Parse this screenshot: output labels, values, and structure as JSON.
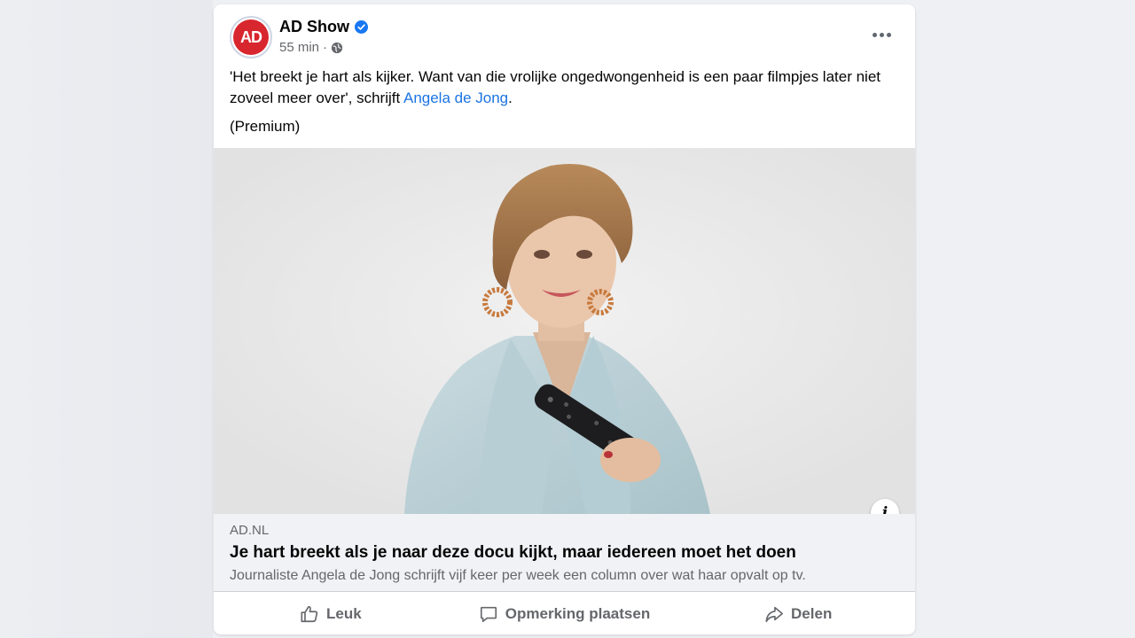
{
  "post": {
    "page_name": "AD Show",
    "avatar_text": "AD",
    "time": "55 min",
    "meta_sep": "·",
    "text_before_link": "'Het breekt je hart als kijker. Want van die vrolijke ongedwongenheid is een paar filmpjes later niet zoveel meer over', schrijft ",
    "author_link": "Angela de Jong",
    "text_after_link": ".",
    "premium": "(Premium)"
  },
  "link_preview": {
    "domain": "AD.NL",
    "title": "Je hart breekt als je naar deze docu kijkt, maar iedereen moet het doen",
    "description": "Journaliste Angela de Jong schrijft vijf keer per week een column over wat haar opvalt op tv."
  },
  "actions": {
    "like": "Leuk",
    "comment": "Opmerking plaatsen",
    "share": "Delen"
  },
  "icons": {
    "verified": "verified-badge-icon",
    "audience": "globe-icon",
    "more": "more-options-icon",
    "info": "info-icon",
    "like": "thumbs-up-icon",
    "comment": "comment-icon",
    "share": "share-icon"
  },
  "colors": {
    "link": "#1b74e4",
    "verified": "#1877f2",
    "brand_red": "#d8262e",
    "secondary_text": "#65676b"
  }
}
